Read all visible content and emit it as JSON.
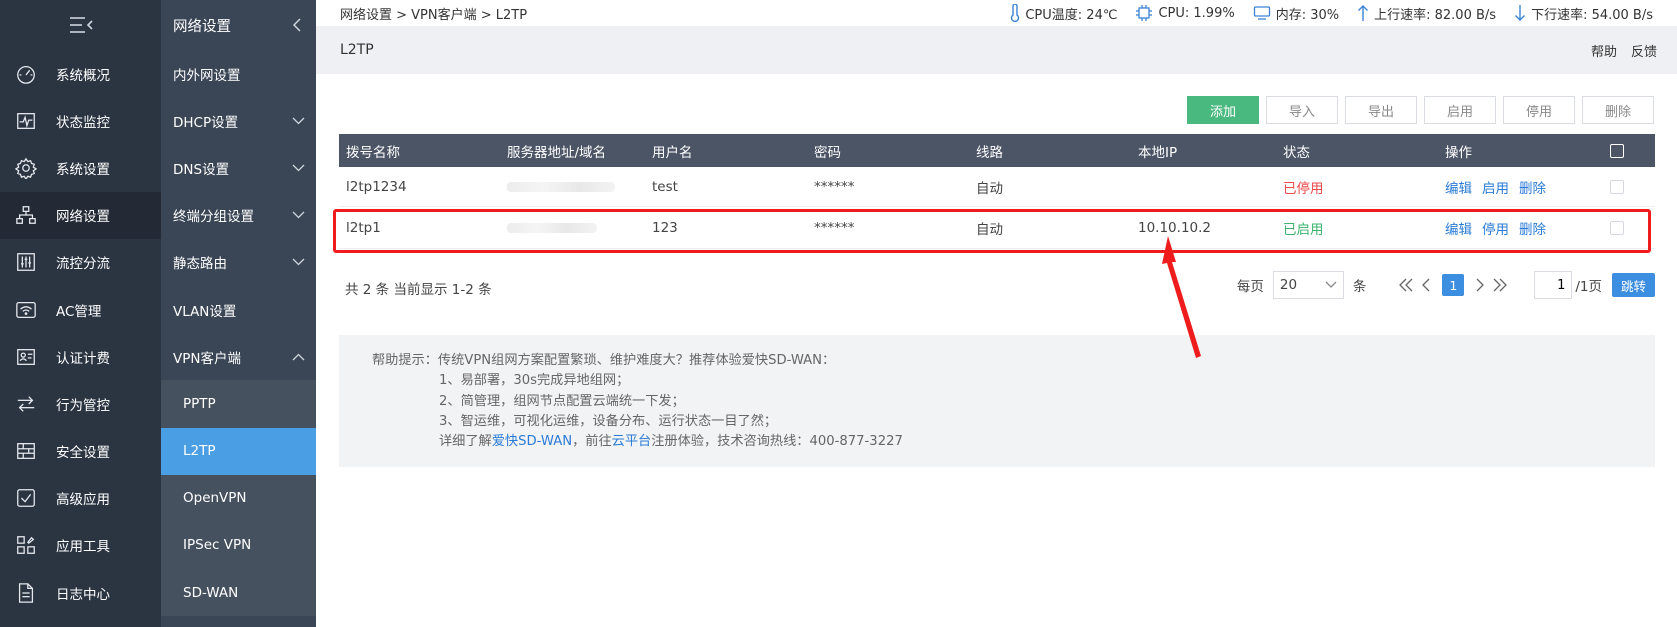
{
  "nav_primary": [
    {
      "label": "系统概况",
      "icon": "dashboard-icon"
    },
    {
      "label": "状态监控",
      "icon": "monitor-icon"
    },
    {
      "label": "系统设置",
      "icon": "gear-icon"
    },
    {
      "label": "网络设置",
      "icon": "network-icon"
    },
    {
      "label": "流控分流",
      "icon": "sliders-icon"
    },
    {
      "label": "AC管理",
      "icon": "wifi-icon"
    },
    {
      "label": "认证计费",
      "icon": "user-card-icon"
    },
    {
      "label": "行为管控",
      "icon": "transfer-icon"
    },
    {
      "label": "安全设置",
      "icon": "firewall-icon"
    },
    {
      "label": "高级应用",
      "icon": "check-box-icon"
    },
    {
      "label": "应用工具",
      "icon": "tools-icon"
    },
    {
      "label": "日志中心",
      "icon": "document-icon"
    }
  ],
  "nav_secondary": {
    "header": "网络设置",
    "items": [
      {
        "label": "内外网设置"
      },
      {
        "label": "DHCP设置"
      },
      {
        "label": "DNS设置"
      },
      {
        "label": "终端分组设置"
      },
      {
        "label": "静态路由"
      },
      {
        "label": "VLAN设置"
      },
      {
        "label": "VPN客户端"
      }
    ],
    "subitems": [
      {
        "label": "PPTP"
      },
      {
        "label": "L2TP"
      },
      {
        "label": "OpenVPN"
      },
      {
        "label": "IPSec VPN"
      },
      {
        "label": "SD-WAN"
      }
    ]
  },
  "breadcrumb": "网络设置 > VPN客户端 > L2TP",
  "stats": {
    "cpu_temp": "CPU温度: 24℃",
    "cpu": "CPU: 1.99%",
    "memory": "内存: 30%",
    "upload": "上行速率: 82.00 B/s",
    "download": "下行速率: 54.00 B/s"
  },
  "page": {
    "title": "L2TP",
    "help": "帮助",
    "feedback": "反馈"
  },
  "toolbar": {
    "add": "添加",
    "import": "导入",
    "export": "导出",
    "enable": "启用",
    "disable": "停用",
    "delete": "删除"
  },
  "table": {
    "headers": [
      "拨号名称",
      "服务器地址/域名",
      "用户名",
      "密码",
      "线路",
      "本地IP",
      "状态",
      "操作"
    ],
    "rows": [
      {
        "name": "l2tp1234",
        "user": "test",
        "password": "******",
        "line": "自动",
        "local_ip": "",
        "status": "已停用",
        "actions": [
          "编辑",
          "启用",
          "删除"
        ]
      },
      {
        "name": "l2tp1",
        "user": "123",
        "password": "******",
        "line": "自动",
        "local_ip": "10.10.10.2",
        "status": "已启用",
        "actions": [
          "编辑",
          "停用",
          "删除"
        ]
      }
    ]
  },
  "pagination": {
    "summary": "共 2 条 当前显示 1-2 条",
    "per_page_label": "每页",
    "per_page": "20",
    "unit": "条",
    "current": "1",
    "jump_value": "1",
    "total_pages": "/1页",
    "go": "跳转"
  },
  "help": {
    "line1": "帮助提示：传统VPN组网方案配置繁琐、维护难度大？推荐体验爱快SD-WAN：",
    "line2": "1、易部署，30s完成异地组网；",
    "line3": "2、简管理，组网节点配置云端统一下发；",
    "line4": "3、智运维，可视化运维，设备分布、运行状态一目了然；",
    "line5_a": "详细了解",
    "line5_link1": "爱快SD-WAN",
    "line5_b": "，前往",
    "line5_link2": "云平台",
    "line5_c": "注册体验，技术咨询热线：400-877-3227"
  },
  "colors": {
    "highlight": "#ee1c1c",
    "add_button": "#4ab97f",
    "link": "#2a7bd6",
    "status_disabled": "#ee4a4a",
    "status_enabled": "#3db46d"
  }
}
